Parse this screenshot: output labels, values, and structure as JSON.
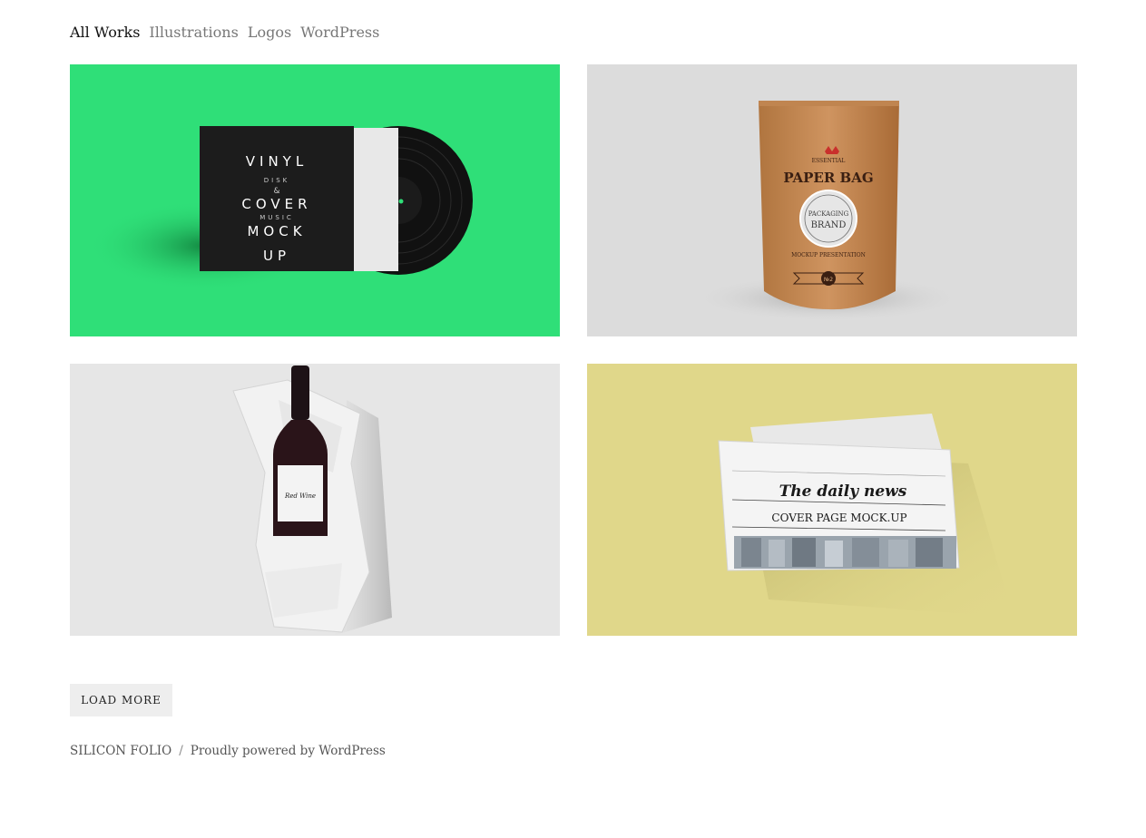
{
  "filters": {
    "all": "All Works",
    "illustrations": "Illustrations",
    "logos": "Logos",
    "wordpress": "WordPress"
  },
  "portfolio": {
    "vinyl": {
      "background": "#2fdf78",
      "cover_lines": [
        "VINYL",
        "DISK",
        "&",
        "COVER",
        "MUSIC",
        "MOCK",
        "UP"
      ]
    },
    "paper_bag": {
      "background": "#dcdcdc",
      "top": "ESSENTIAL",
      "title": "PAPER BAG",
      "badge_line1": "PACKAGING",
      "badge_line2": "BRAND",
      "caption": "MOCKUP PRESENTATION",
      "number": "№2"
    },
    "wine": {
      "background": "#e6e6e6",
      "label": "Red Wine"
    },
    "newspaper": {
      "background": "#e0d78a",
      "masthead": "The daily news",
      "headline": "COVER PAGE MOCK.UP"
    }
  },
  "load_more": "LOAD MORE",
  "footer": {
    "site_name": "SILICON FOLIO",
    "separator": "/",
    "powered": "Proudly powered by WordPress"
  }
}
